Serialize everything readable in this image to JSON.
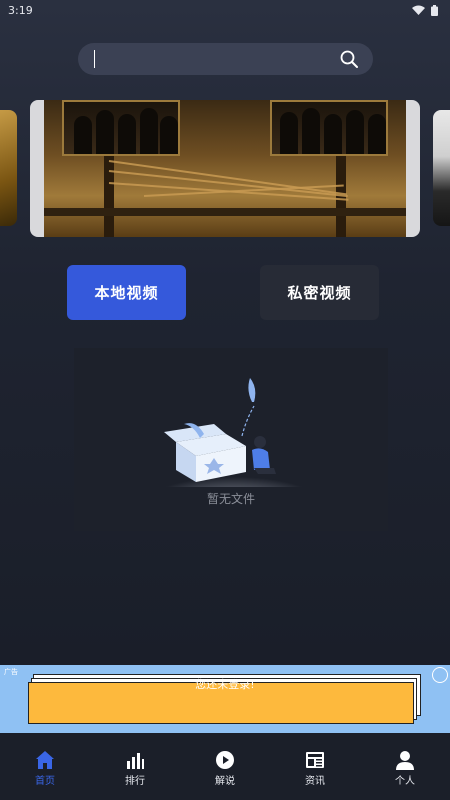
{
  "status_bar": {
    "time": "3:19"
  },
  "search": {
    "placeholder": "",
    "value": "",
    "icon": "search-icon"
  },
  "tabs": [
    {
      "label": "本地视频",
      "active": true
    },
    {
      "label": "私密视频",
      "active": false
    }
  ],
  "empty_state": {
    "message": "暂无文件"
  },
  "ad": {
    "tag": "广告",
    "message": "您还未登录!"
  },
  "bottom_nav": [
    {
      "label": "首页",
      "icon": "home-icon",
      "active": true
    },
    {
      "label": "排行",
      "icon": "ranking-icon",
      "active": false
    },
    {
      "label": "解说",
      "icon": "play-icon",
      "active": false
    },
    {
      "label": "资讯",
      "icon": "news-icon",
      "active": false
    },
    {
      "label": "个人",
      "icon": "person-icon",
      "active": false
    }
  ],
  "colors": {
    "accent": "#3559db",
    "nav_active": "#3a66e6",
    "ad_background": "#8fc1f3",
    "ad_card": "#fdb93d"
  }
}
